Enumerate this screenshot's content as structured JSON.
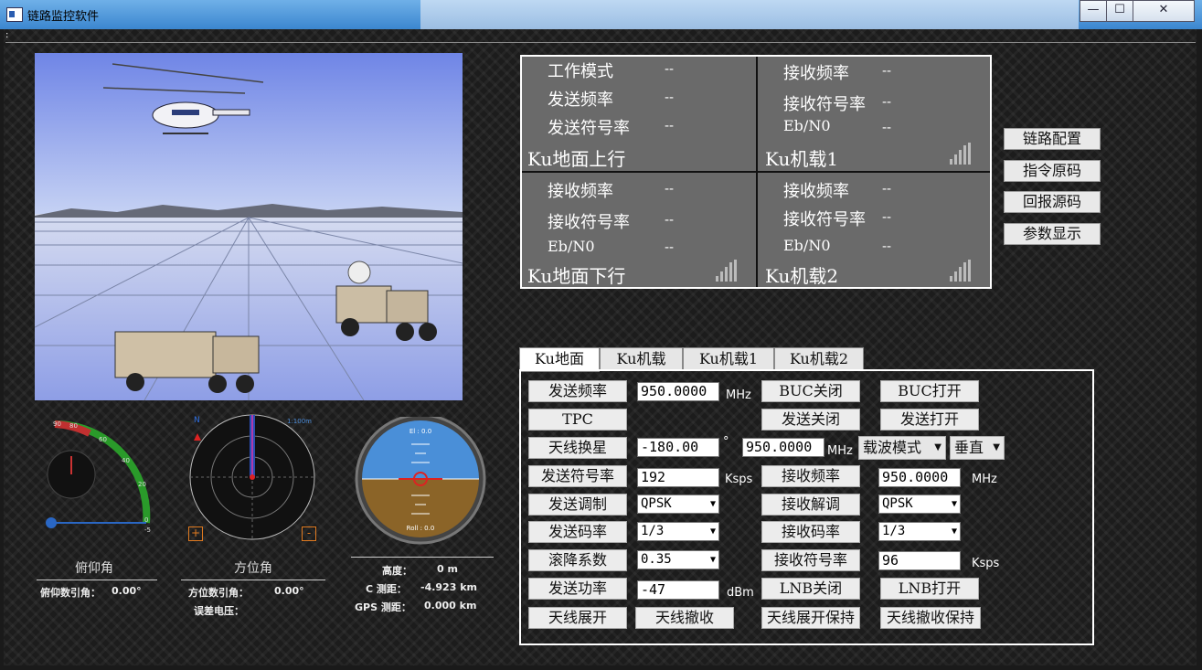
{
  "window": {
    "title": "链路监控软件",
    "min": "—",
    "max": "☐",
    "close": "✕"
  },
  "menu": {
    "label": ":"
  },
  "gauges": {
    "pitch": {
      "title": "俯仰角",
      "label": "俯仰数引角：",
      "value": "0.00°",
      "ticks": [
        "90",
        "80",
        "60",
        "40",
        "20",
        "0",
        "-5"
      ]
    },
    "azimuth": {
      "title": "方位角",
      "label": "方位数引角：",
      "value": "0.00°",
      "error_label": "误差电压：",
      "error_value": "",
      "north": "N",
      "scale": "1:100m",
      "plus": "+",
      "minus": "-"
    },
    "attitude": {
      "top": "El : 0.0",
      "bottom": "Roll : 0.0"
    },
    "info": {
      "height_label": "高度：",
      "height_value": "0 m",
      "c_label": "C 测距：",
      "c_value": "-4.923 km",
      "gps_label": "GPS 测距：",
      "gps_value": "0.000 km"
    }
  },
  "status": {
    "ground_up": {
      "title": "Ku地面上行",
      "mode_label": "工作模式",
      "mode_value": "--",
      "tx_freq_label": "发送频率",
      "tx_freq_value": "--",
      "tx_rate_label": "发送符号率",
      "tx_rate_value": "--"
    },
    "air1": {
      "title": "Ku机载1",
      "rx_freq_label": "接收频率",
      "rx_freq_value": "--",
      "rx_rate_label": "接收符号率",
      "rx_rate_value": "--",
      "ebn0_label": "Eb/N0",
      "ebn0_value": "--"
    },
    "ground_down": {
      "title": "Ku地面下行",
      "rx_freq_label": "接收频率",
      "rx_freq_value": "--",
      "rx_rate_label": "接收符号率",
      "rx_rate_value": "--",
      "ebn0_label": "Eb/N0",
      "ebn0_value": "--"
    },
    "air2": {
      "title": "Ku机载2",
      "rx_freq_label": "接收频率",
      "rx_freq_value": "--",
      "rx_rate_label": "接收符号率",
      "rx_rate_value": "--",
      "ebn0_label": "Eb/N0",
      "ebn0_value": "--"
    }
  },
  "side_buttons": [
    "链路配置",
    "指令原码",
    "回报源码",
    "参数显示"
  ],
  "tabs": [
    "Ku地面",
    "Ku机载",
    "Ku机载1",
    "Ku机载2"
  ],
  "panel": {
    "tx_freq_btn": "发送频率",
    "tx_freq_value": "950.0000",
    "tx_freq_unit": "MHz",
    "buc_off": "BUC关闭",
    "buc_on": "BUC打开",
    "tpc": "TPC",
    "tx_off": "发送关闭",
    "tx_on": "发送打开",
    "sat_switch": "天线换星",
    "sat_angle": "-180.00",
    "deg": "°",
    "sat_freq": "950.0000",
    "sat_freq_unit": "MHz",
    "carrier_mode": "载波模式",
    "polarization": "垂直",
    "tx_rate_btn": "发送符号率",
    "tx_rate_value": "192",
    "tx_rate_unit": "Ksps",
    "rx_freq_btn": "接收频率",
    "rx_freq_value": "950.0000",
    "rx_freq_unit": "MHz",
    "tx_mod_btn": "发送调制",
    "tx_mod_value": "QPSK",
    "rx_demod_btn": "接收解调",
    "rx_demod_value": "QPSK",
    "tx_code_btn": "发送码率",
    "tx_code_value": "1/3",
    "rx_code_btn": "接收码率",
    "rx_code_value": "1/3",
    "rolloff_btn": "滚降系数",
    "rolloff_value": "0.35",
    "rx_rate_btn": "接收符号率",
    "rx_rate_value": "96",
    "rx_rate_unit": "Ksps",
    "tx_power_btn": "发送功率",
    "tx_power_value": "-47",
    "tx_power_unit": "dBm",
    "lnb_off": "LNB关闭",
    "lnb_on": "LNB打开",
    "ant_deploy": "天线展开",
    "ant_stow": "天线撤收",
    "ant_deploy_hold": "天线展开保持",
    "ant_stow_hold": "天线撤收保持"
  }
}
